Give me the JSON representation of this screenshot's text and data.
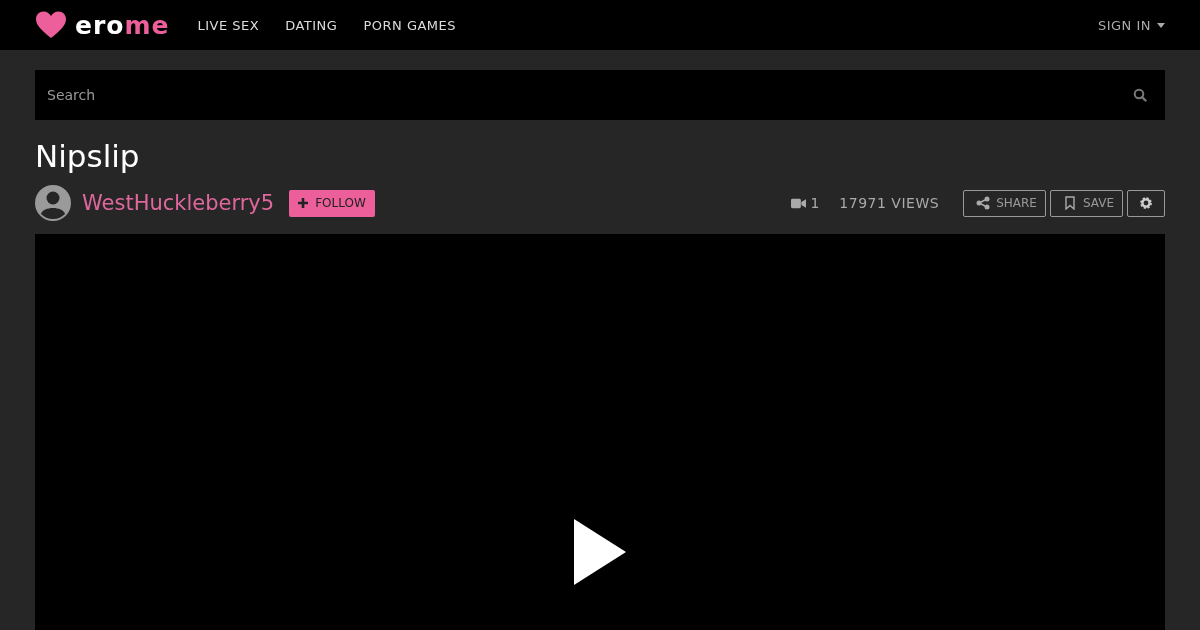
{
  "header": {
    "logo": {
      "plain": "ero",
      "accent": "me"
    },
    "nav": [
      {
        "label": "LIVE SEX"
      },
      {
        "label": "DATING"
      },
      {
        "label": "PORN GAMES"
      }
    ],
    "sign_in": "SIGN IN"
  },
  "search": {
    "placeholder": "Search"
  },
  "album": {
    "title": "Nipslip",
    "user": "WestHuckleberry5",
    "follow": "FOLLOW",
    "video_count": "1",
    "views": "17971 VIEWS",
    "actions": [
      {
        "kind": "share",
        "label": "SHARE"
      },
      {
        "kind": "save",
        "label": "SAVE"
      },
      {
        "kind": "settings"
      }
    ]
  },
  "player": {
    "kind": "video"
  }
}
